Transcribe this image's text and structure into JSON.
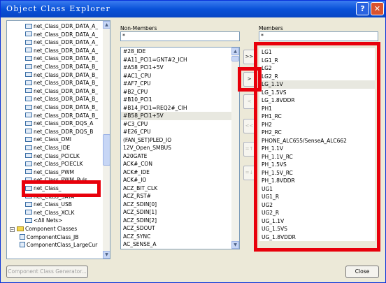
{
  "window": {
    "title": "Object Class Explorer",
    "help": "?",
    "close": "✕"
  },
  "tree": {
    "items": [
      {
        "label": "net_Class_DDR_DATA_A_"
      },
      {
        "label": "net_Class_DDR_DATA_A_"
      },
      {
        "label": "net_Class_DDR_DATA_A_"
      },
      {
        "label": "net_Class_DDR_DATA_A_"
      },
      {
        "label": "net_Class_DDR_DATA_B_"
      },
      {
        "label": "net_Class_DDR_DATA_B_"
      },
      {
        "label": "net_Class_DDR_DATA_B_"
      },
      {
        "label": "net_Class_DDR_DATA_B_"
      },
      {
        "label": "net_Class_DDR_DATA_B_"
      },
      {
        "label": "net_Class_DDR_DATA_B_"
      },
      {
        "label": "net_Class_DDR_DATA_B_"
      },
      {
        "label": "net_Class_DDR_DATA_B_"
      },
      {
        "label": "net_Class_DDR_DQS_A"
      },
      {
        "label": "net_Class_DDR_DQS_B"
      },
      {
        "label": "net_Class_DMI"
      },
      {
        "label": "net_Class_IDE"
      },
      {
        "label": "net_Class_PCICLK"
      },
      {
        "label": "net_Class_PCIECLK"
      },
      {
        "label": "net_Class_PWM"
      },
      {
        "label": "net_Class_PWM_Puls"
      },
      {
        "label": "net_Class_"
      },
      {
        "label": "net_Class_SATA"
      },
      {
        "label": "net_Class_USB"
      },
      {
        "label": "net_Class_XCLK"
      },
      {
        "label": "<All Nets>"
      }
    ],
    "component_classes": "Component Classes",
    "component_items": [
      "ComponentClass_JB",
      "ComponentClass_LargeCur"
    ]
  },
  "non_members": {
    "header": "Non-Members",
    "filter": "*",
    "items": [
      "#28_IDE",
      "#A11_PCI1=GNT#2_ICH",
      "#A58_PCI1+5V",
      "#AC1_CPU",
      "#AF7_CPU",
      "#B2_CPU",
      "#B10_PCI1",
      "#B14_PCI1=REQ2#_CIH",
      "#B58_PCI1+5V",
      "#C3_CPU",
      "#E26_CPU",
      "(FAN_SET)PLED_IO",
      "12V_Open_SMBUS",
      "A20GATE",
      "ACK#_CON",
      "ACK#_IDE",
      "ACK#_IO",
      "ACZ_BIT_CLK",
      "ACZ_RST#",
      "ACZ_SDIN[0]",
      "ACZ_SDIN[1]",
      "ACZ_SDIN[2]",
      "ACZ_SDOUT",
      "ACZ_SYNC",
      "AC_SENSE_A"
    ]
  },
  "members": {
    "header": "Members",
    "filter": "*",
    "items": [
      "LG1",
      "LG1_R",
      "LG2",
      "LG2_R",
      "LG_1.1V",
      "LG_1.5VS",
      "LG_1.8VDDR",
      "PH1",
      "PH1_RC",
      "PH2",
      "PH2_RC",
      "PHONE_ALC655/SenseA_ALC662",
      "PH_1.1V",
      "PH_1.1V_RC",
      "PH_1.5VS",
      "PH_1.5V_RC",
      "PH_1.8VDDR",
      "UG1",
      "UG1_R",
      "UG2",
      "UG2_R",
      "UG_1.1V",
      "UG_1.5VS",
      "UG_1.8VDDR"
    ]
  },
  "transfer": {
    "add_all": ">>",
    "add": ">",
    "remove": "<",
    "remove_all": "<<",
    "add_class": "=↑",
    "remove_class": "=↓"
  },
  "footer": {
    "generator": "Component Class Generator...",
    "close": "Close"
  },
  "colors": {
    "highlight": "#e8000b",
    "titlebar": "#0a52d8"
  }
}
